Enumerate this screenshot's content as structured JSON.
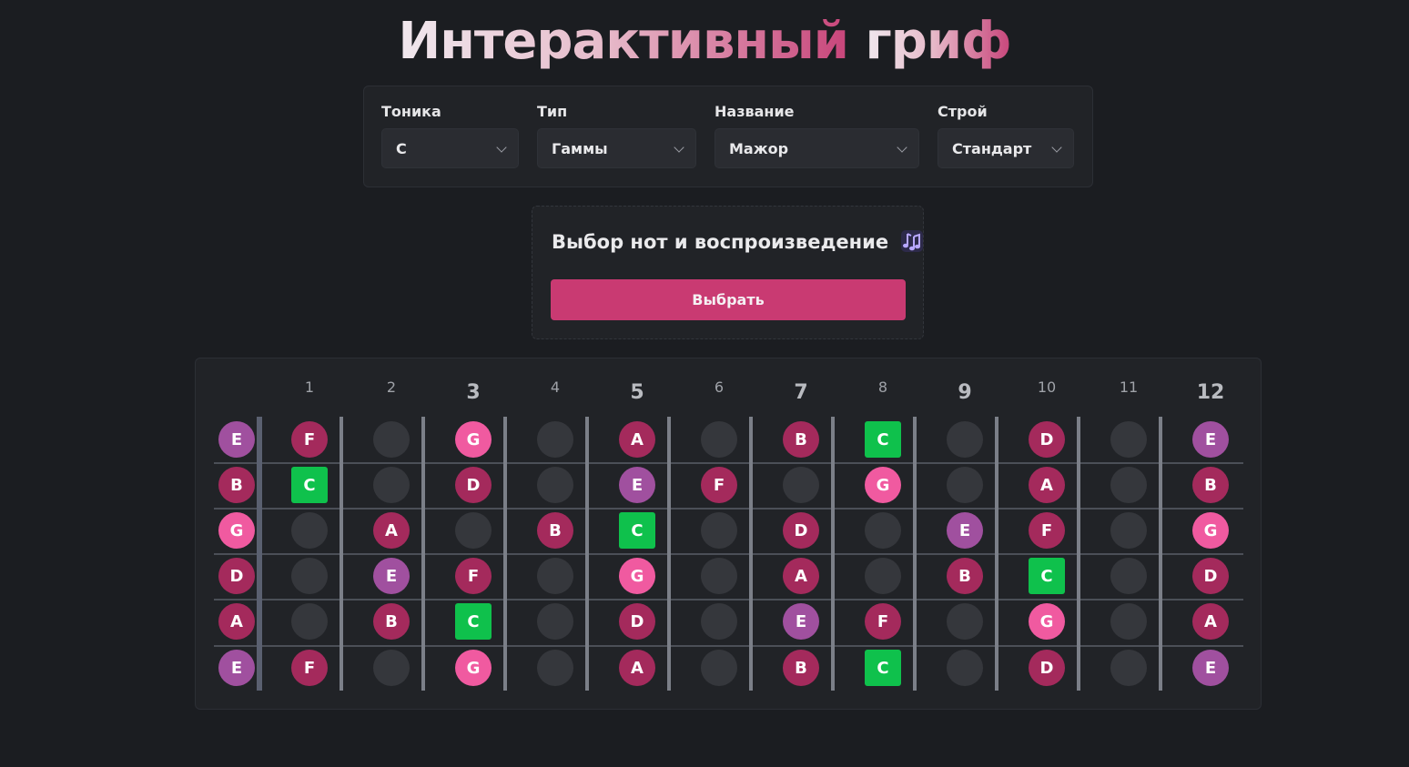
{
  "header": {
    "title_part1": "Интерактивный",
    "title_part2": "гриф"
  },
  "controls": {
    "tonic": {
      "label": "Тоника",
      "value": "C"
    },
    "type": {
      "label": "Тип",
      "value": "Гаммы"
    },
    "name": {
      "label": "Название",
      "value": "Мажор"
    },
    "tuning": {
      "label": "Строй",
      "value": "Стандартный"
    }
  },
  "playback": {
    "title": "Выбор нот и воспроизведение",
    "icon": "music-notes-icon",
    "button_label": "Выбрать"
  },
  "colors": {
    "accent": "#c93a72",
    "root_note": "#0fc14c",
    "note_C": "#0fc14c",
    "note_D": "#a42a5c",
    "note_E": "#a0509f",
    "note_F": "#a42a5c",
    "note_G": "#f05aa0",
    "note_A": "#a42a5c",
    "note_B": "#a42a5c",
    "empty": "#35373c"
  },
  "fretboard": {
    "fret_numbers": [
      "1",
      "2",
      "3",
      "4",
      "5",
      "6",
      "7",
      "8",
      "9",
      "10",
      "11",
      "12"
    ],
    "marked_frets": [
      "3",
      "5",
      "7",
      "9",
      "12"
    ],
    "strings": [
      [
        "E",
        "F",
        "",
        "G",
        "",
        "A",
        "",
        "B",
        "C",
        "",
        "D",
        "",
        "E"
      ],
      [
        "B",
        "C",
        "",
        "D",
        "",
        "E",
        "F",
        "",
        "G",
        "",
        "A",
        "",
        "B"
      ],
      [
        "G",
        "",
        "A",
        "",
        "B",
        "C",
        "",
        "D",
        "",
        "E",
        "F",
        "",
        "G"
      ],
      [
        "D",
        "",
        "E",
        "F",
        "",
        "G",
        "",
        "A",
        "",
        "B",
        "C",
        "",
        "D"
      ],
      [
        "A",
        "",
        "B",
        "C",
        "",
        "D",
        "",
        "E",
        "F",
        "",
        "G",
        "",
        "A"
      ],
      [
        "E",
        "F",
        "",
        "G",
        "",
        "A",
        "",
        "B",
        "C",
        "",
        "D",
        "",
        "E"
      ]
    ]
  }
}
